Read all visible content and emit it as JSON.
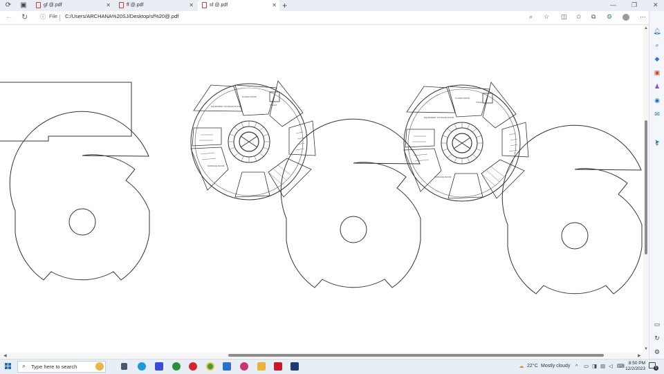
{
  "browser": {
    "tabs": [
      {
        "title": "gf @.pdf",
        "active": false
      },
      {
        "title": "ff @.pdf",
        "active": false
      },
      {
        "title": "sf @.pdf",
        "active": true
      }
    ],
    "new_tab_symbol": "+",
    "window_controls": {
      "minimize": "—",
      "restore": "❐",
      "close": "✕"
    },
    "address": {
      "scheme_label": "File",
      "url": "C:/Users/ARCHANA%20SJ/Desktop/sf%20@.pdf"
    },
    "toolbar_icons": [
      "zoom-icon",
      "favorite-star-icon",
      "split-screen-icon",
      "favorites-icon",
      "collections-icon",
      "extensions-icon",
      "profile-icon",
      "more-icon",
      "copilot-icon"
    ]
  },
  "sidebar": {
    "items": [
      "bell-icon",
      "search-icon",
      "tag-icon",
      "briefcase-icon",
      "games-icon",
      "office-icon",
      "outlook-icon",
      "send-icon",
      "add-icon"
    ],
    "bottom_items": [
      "panel-icon",
      "refresh-icon",
      "settings-icon"
    ]
  },
  "pdf": {
    "drawing_labels": [
      "EQUIPMENT STORAGE ROOM",
      "TOILET",
      "GUARD ROOM",
      "SURFACE ROOM",
      "EQUIPMENT STORAGE ROOM",
      "GUARD ROOM",
      "SURFACE ROOM",
      "TOILET"
    ]
  },
  "taskbar": {
    "search_placeholder": "Type here to search",
    "apps": [
      "widgets-icon",
      "task-view-icon",
      "edge-icon",
      "vscode-icon",
      "xbox-icon",
      "opera-icon",
      "chrome-icon",
      "mail-icon",
      "opera-gx-icon",
      "file-explorer-icon",
      "acrobat-icon",
      "photoshop-icon"
    ],
    "weather": {
      "temp": "22°C",
      "condition": "Mostly cloudy"
    },
    "clock": {
      "time": "8:50 PM",
      "date": "12/2/2023"
    },
    "notifications_count": "1"
  },
  "colors": {
    "accent": "#1f6fc0",
    "pdf_red": "#d03a3a",
    "scroll_thumb": "#8c8c8c"
  }
}
